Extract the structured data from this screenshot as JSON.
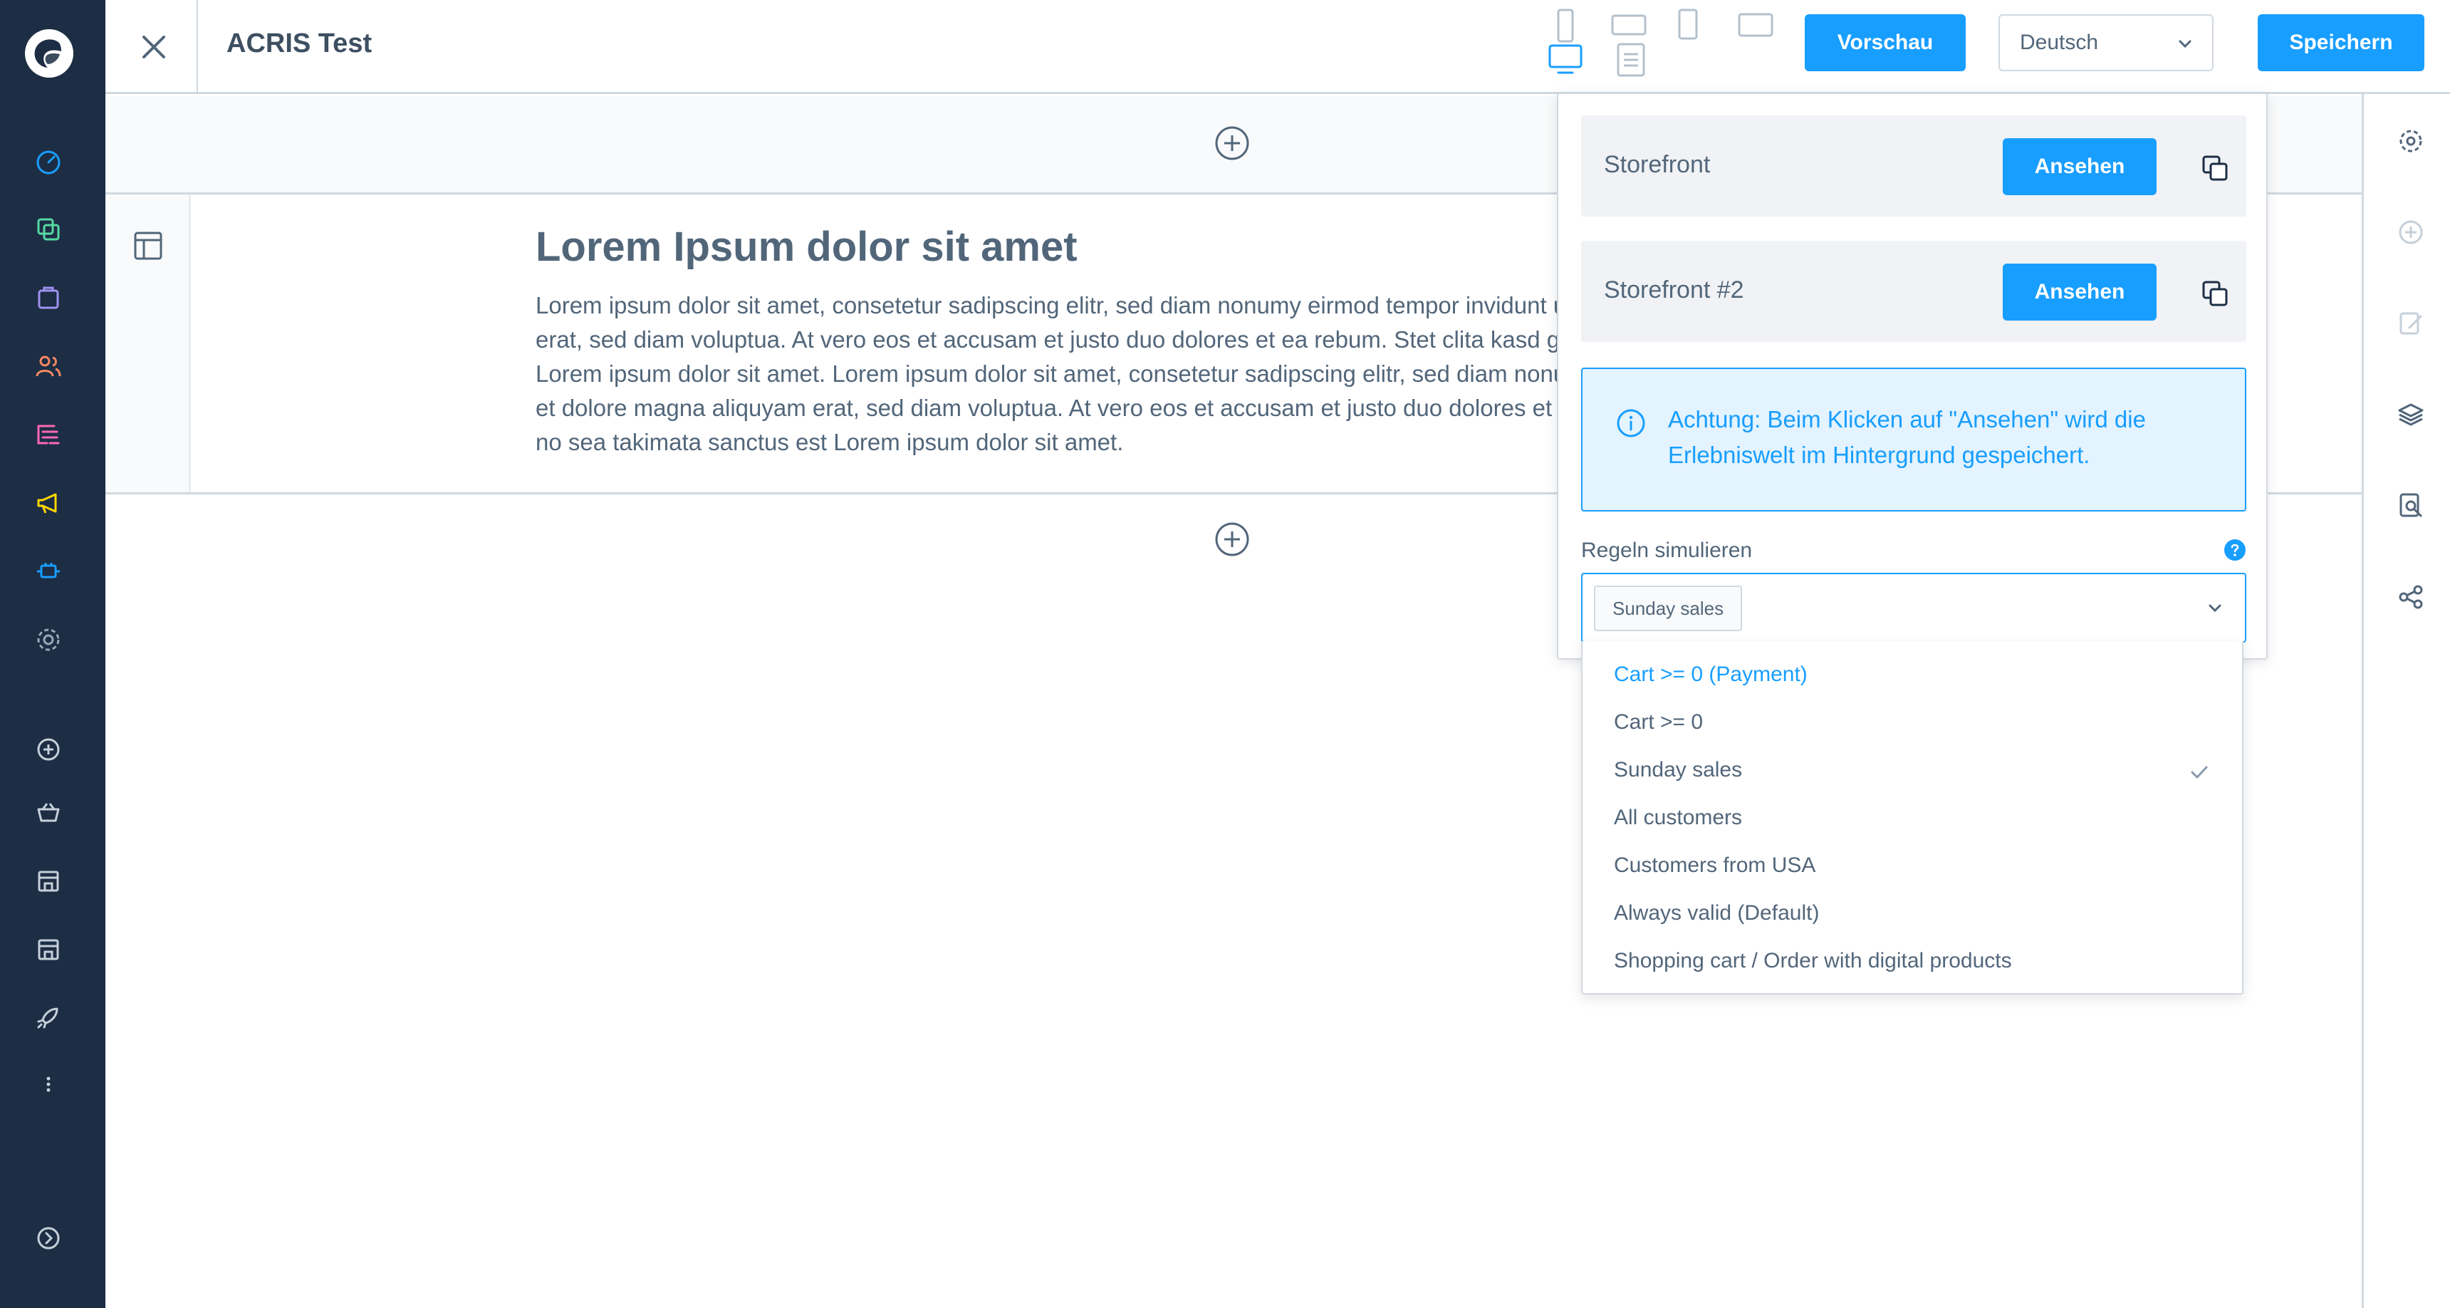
{
  "topbar": {
    "title": "ACRIS Test",
    "preview_label": "Vorschau",
    "language_value": "Deutsch",
    "save_label": "Speichern"
  },
  "content": {
    "heading": "Lorem Ipsum dolor sit amet",
    "text_lines": [
      "Lorem ipsum dolor sit amet, consetetur sadipscing elitr, sed diam nonumy eirmod tempor invidunt ut labore et dolore magna aliquyam",
      "erat, sed diam voluptua. At vero eos et accusam et justo duo dolores et ea rebum. Stet clita kasd gubergren, no sea takimata sanctus est",
      "Lorem ipsum dolor sit amet. Lorem ipsum dolor sit amet, consetetur sadipscing elitr, sed diam nonumy eirmod tempor invidunt ut labore",
      "et dolore magna aliquyam erat, sed diam voluptua. At vero eos et accusam et justo duo dolores et ea rebum. Stet clita kasd gubergren,",
      "no sea takimata sanctus est Lorem ipsum dolor sit amet."
    ]
  },
  "preview": {
    "storefronts": [
      {
        "name": "Storefront",
        "button": "Ansehen"
      },
      {
        "name": "Storefront #2",
        "button": "Ansehen"
      }
    ],
    "notice": "Achtung: Beim Klicken auf \"Ansehen\" wird die Erlebniswelt im Hintergrund gespeichert.",
    "rules_label": "Regeln simulieren",
    "selected_rule": "Sunday sales",
    "rule_options": [
      "Cart >= 0 (Payment)",
      "Cart >= 0",
      "Sunday sales",
      "All customers",
      "Customers from USA",
      "Always valid (Default)",
      "Shopping cart / Order with digital products"
    ]
  },
  "colors": {
    "nav_bg": "#1c2d44",
    "primary": "#189eff",
    "text": "#52667a",
    "border": "#d1d9e0"
  },
  "icons": {
    "main_nav": [
      "dashboard-icon",
      "catalog-icon",
      "orders-icon",
      "customers-icon",
      "content-icon",
      "marketing-icon",
      "extensions-icon",
      "settings-icon",
      "add-icon",
      "basket-icon",
      "storefront-icon",
      "storefront-2-icon",
      "rocket-icon",
      "more-icon",
      "expand-icon"
    ],
    "right_sidebar": [
      "settings-icon",
      "add-block-icon",
      "edit-icon",
      "layers-icon",
      "search-page-icon",
      "share-icon"
    ]
  }
}
